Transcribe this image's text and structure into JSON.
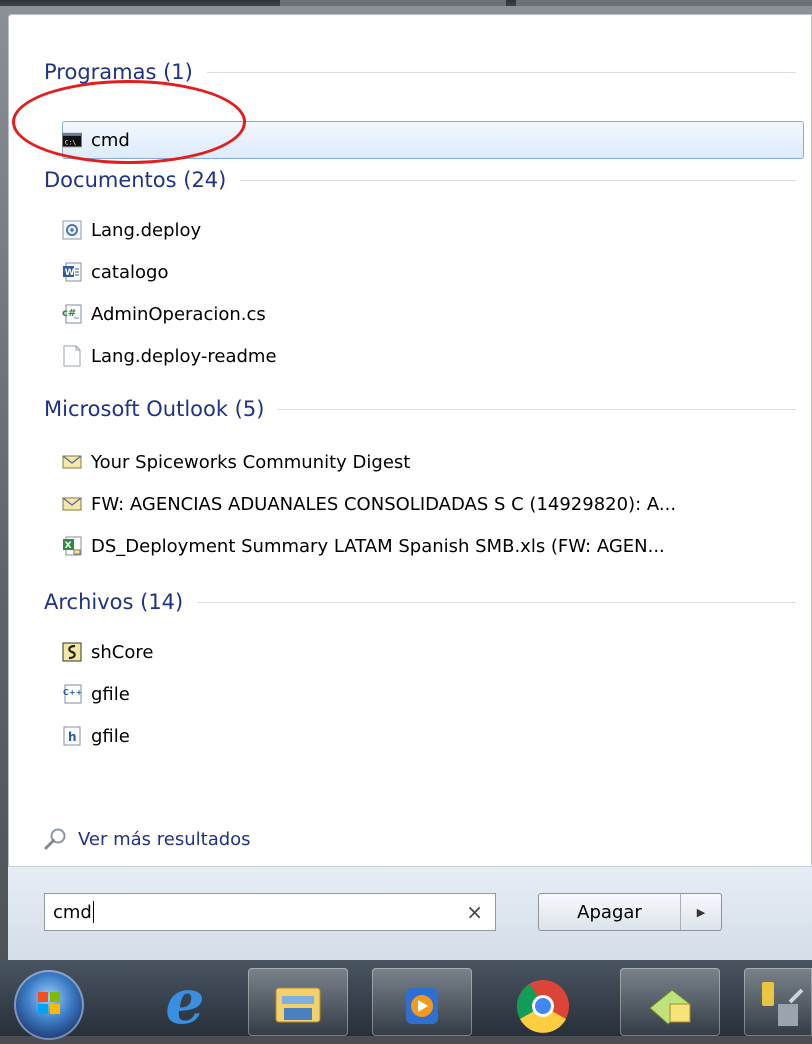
{
  "sections": [
    {
      "header": "Programas (1)",
      "items": [
        {
          "label": "cmd",
          "icon": "cmd-icon"
        }
      ]
    },
    {
      "header": "Documentos (24)",
      "items": [
        {
          "label": "Lang.deploy",
          "icon": "deploy-file-icon"
        },
        {
          "label": "catalogo",
          "icon": "word-document-icon"
        },
        {
          "label": "AdminOperacion.cs",
          "icon": "csharp-file-icon"
        },
        {
          "label": "Lang.deploy-readme",
          "icon": "text-file-icon"
        }
      ]
    },
    {
      "header": "Microsoft Outlook (5)",
      "items": [
        {
          "label": "Your Spiceworks Community Digest",
          "icon": "email-icon"
        },
        {
          "label": "FW: AGENCIAS ADUANALES CONSOLIDADAS S C (14929820): A...",
          "icon": "email-icon"
        },
        {
          "label": "DS_Deployment Summary LATAM Spanish SMB.xls (FW: AGEN...",
          "icon": "excel-attachment-icon"
        }
      ]
    },
    {
      "header": "Archivos (14)",
      "items": [
        {
          "label": "shCore",
          "icon": "script-file-icon"
        },
        {
          "label": "gfile",
          "icon": "cpp-file-icon"
        },
        {
          "label": "gfile",
          "icon": "header-file-icon"
        }
      ]
    }
  ],
  "see_more": "Ver más resultados",
  "search": {
    "value": "cmd",
    "clear_glyph": "×"
  },
  "shutdown": {
    "label": "Apagar",
    "arrow_glyph": "▶"
  },
  "taskbar": [
    "start-orb-icon",
    "internet-explorer-icon",
    "file-explorer-icon",
    "media-player-icon",
    "chrome-icon",
    "app-icon",
    "tools-icon"
  ],
  "colors": {
    "header": "#1e3287",
    "selection_border": "#84acdd",
    "annotation": "#e41c1c"
  }
}
